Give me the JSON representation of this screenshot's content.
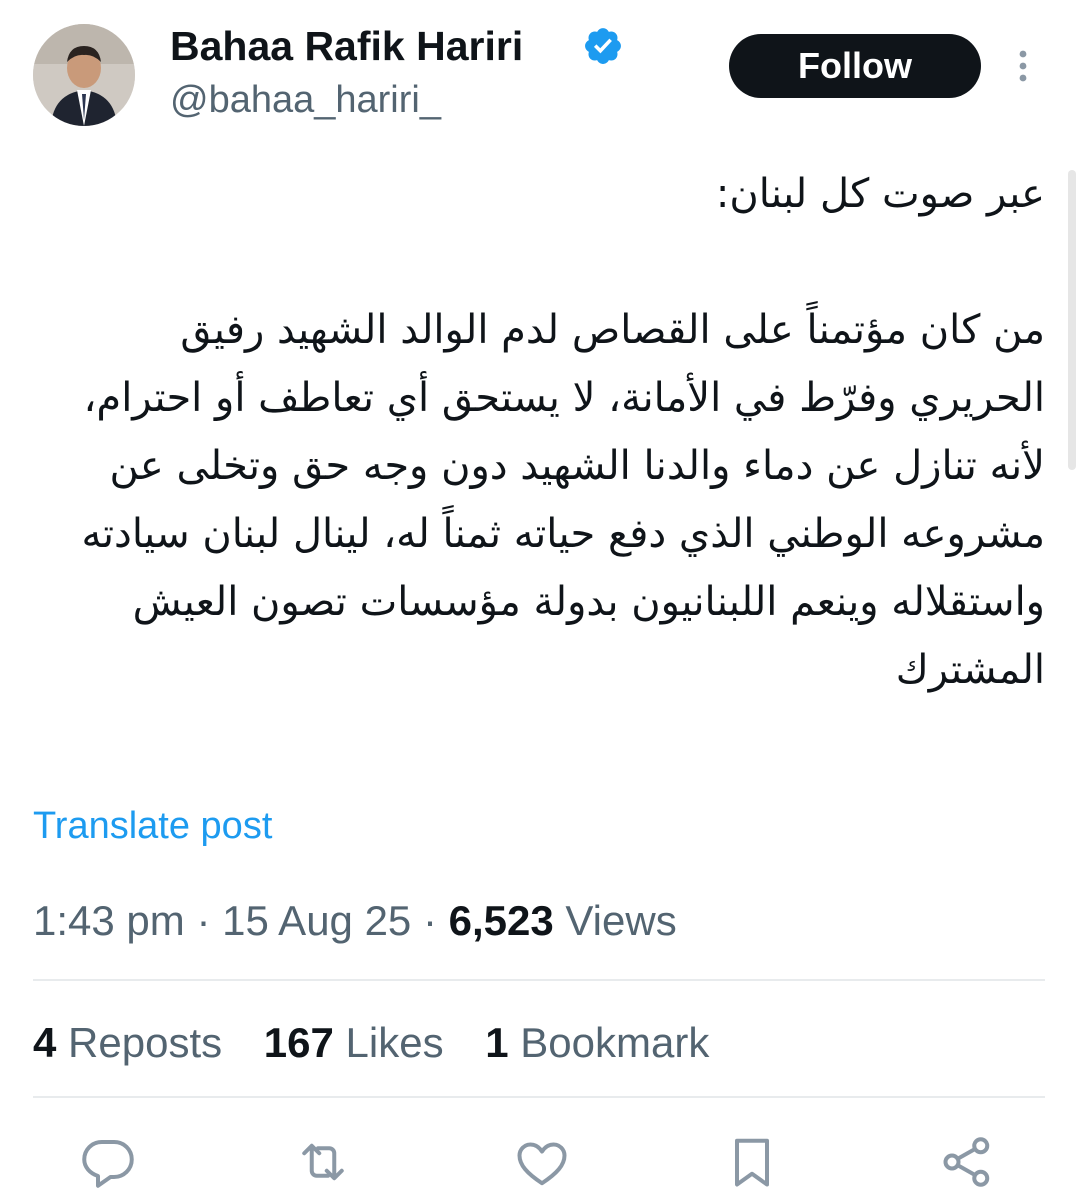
{
  "author": {
    "display_name": "Bahaa Rafik Hariri",
    "handle": "@bahaa_hariri_",
    "verified_icon": "verified-badge-icon",
    "avatar_icon": "avatar"
  },
  "header": {
    "follow_label": "Follow",
    "more_icon": "more-vertical-icon"
  },
  "tweet": {
    "line_1": "عبر صوت كل لبنان:",
    "line_2": "من كان مؤتمناً على القصاص لدم الوالد الشهيد رفيق الحريري وفرّط في الأمانة، لا يستحق أي تعاطف أو احترام، لأنه تنازل عن دماء والدنا الشهيد دون وجه حق وتخلى عن مشروعه الوطني الذي دفع حياته ثمناً له، لينال لبنان سيادته واستقلاله وينعم اللبنانيون بدولة مؤسسات تصون العيش المشترك",
    "translate_label": "Translate post"
  },
  "meta": {
    "time": "1:43 pm",
    "separator": "·",
    "date": "15 Aug 25",
    "views_count": "6,523",
    "views_label": "Views"
  },
  "stats": {
    "reposts_count": "4",
    "reposts_label": "Reposts",
    "likes_count": "167",
    "likes_label": "Likes",
    "bookmarks_count": "1",
    "bookmarks_label": "Bookmark"
  },
  "actions": [
    "reply-icon",
    "repost-icon",
    "like-icon",
    "bookmark-icon",
    "share-icon"
  ],
  "colors": {
    "text": "#0f1419",
    "secondary": "#536471",
    "link": "#1d9bf0",
    "verified": "#1d9bf0",
    "button_bg": "#0f1419",
    "divider": "#e8ebed"
  }
}
